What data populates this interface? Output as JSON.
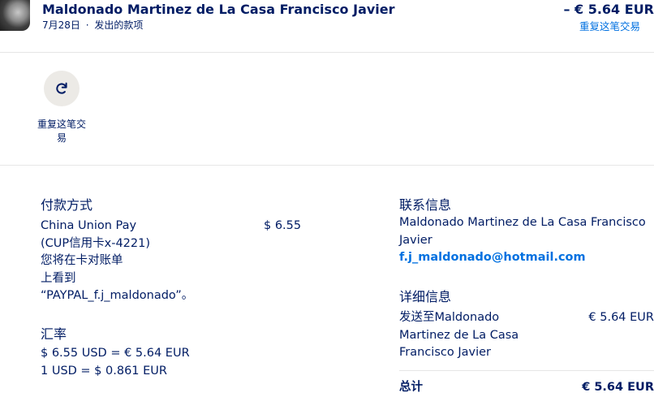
{
  "transaction": {
    "name": "Maldonado Martinez de La Casa Francisco Javier",
    "date": "7月28日",
    "separator": "·",
    "type": "发出的款项",
    "amount": "– € 5.64 EUR",
    "repeat_link": "重复这笔交易"
  },
  "actions": {
    "repeat_label_line1": "重复这笔交",
    "repeat_label_line2": "易",
    "repeat_icon": "refresh-icon"
  },
  "payment": {
    "heading": "付款方式",
    "method": "China Union Pay",
    "card": "(CUP信用卡x-4221)",
    "note_line1": "您将在卡对账单",
    "note_line2": "上看到",
    "note_line3": "“PAYPAL_f.j_maldonado”。",
    "method_amount": "$ 6.55"
  },
  "exchange": {
    "heading": "汇率",
    "line1": "$ 6.55 USD = € 5.64 EUR",
    "line2": "1 USD = $ 0.861 EUR"
  },
  "contact": {
    "heading": "联系信息",
    "name_line1": "Maldonado Martinez de La Casa Francisco",
    "name_line2": "Javier",
    "email": "f.j_maldonado@hotmail.com"
  },
  "details": {
    "heading": "详细信息",
    "sent_to_line1": "发送至Maldonado",
    "sent_to_line2": "Martinez de La Casa",
    "sent_to_line3": "Francisco Javier",
    "sent_amount": "€ 5.64 EUR",
    "total_label": "总计",
    "total_amount": "€ 5.64 EUR"
  },
  "colors": {
    "text": "#001c64",
    "link": "#0070e0",
    "icon_bg": "#eceae6"
  }
}
